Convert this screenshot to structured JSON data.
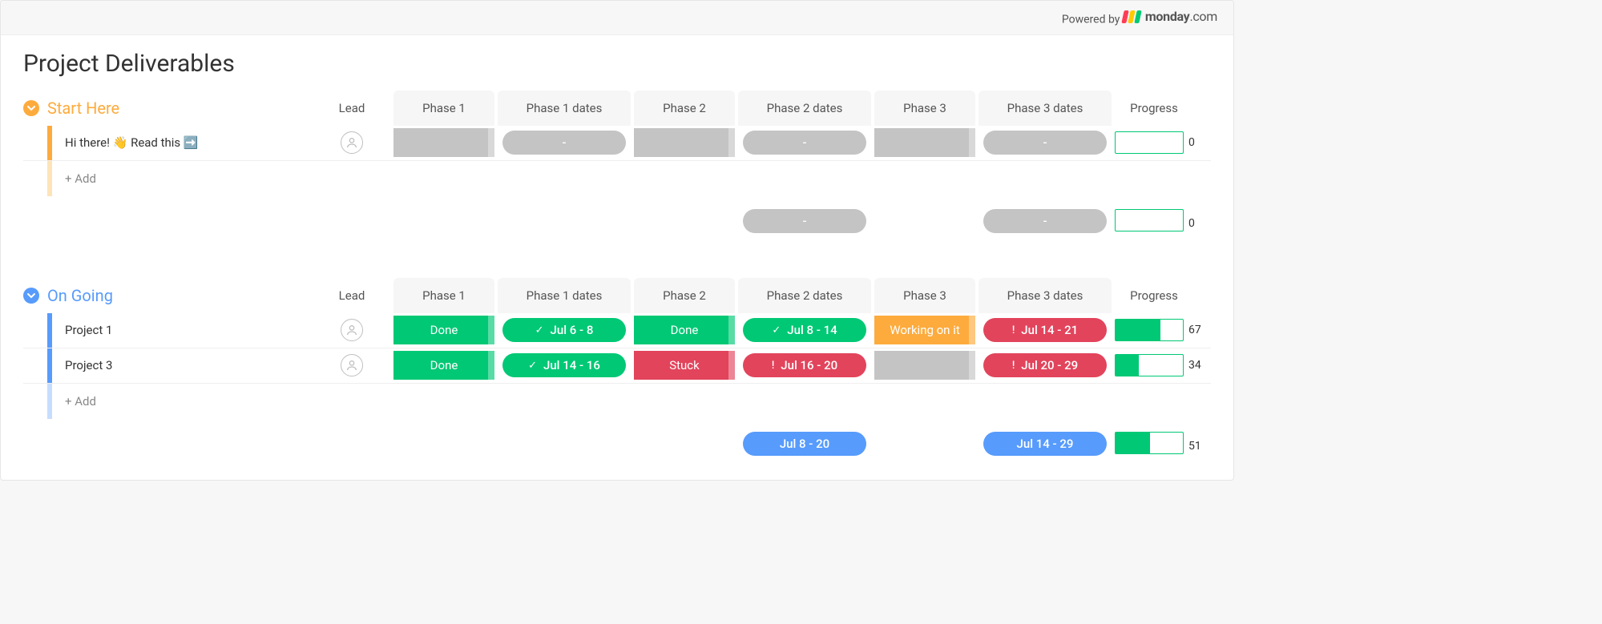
{
  "topbar": {
    "powered_by": "Powered by",
    "brand": "monday",
    "brand_suffix": ".com"
  },
  "board": {
    "title": "Project Deliverables"
  },
  "columns": {
    "lead": "Lead",
    "phase1": "Phase 1",
    "phase1_dates": "Phase 1 dates",
    "phase2": "Phase 2",
    "phase2_dates": "Phase 2 dates",
    "phase3": "Phase 3",
    "phase3_dates": "Phase 3 dates",
    "progress": "Progress"
  },
  "groups": {
    "start_here": {
      "title": "Start Here",
      "color": "yellow",
      "rows": [
        {
          "name": "Hi there! 👋 Read this ➡️",
          "lead": "unassigned",
          "phase1": {
            "label": "",
            "style": "grey"
          },
          "phase1_dates": {
            "text": "-",
            "style": "grey"
          },
          "phase2": {
            "label": "",
            "style": "grey"
          },
          "phase2_dates": {
            "text": "-",
            "style": "grey"
          },
          "phase3": {
            "label": "",
            "style": "grey"
          },
          "phase3_dates": {
            "text": "-",
            "style": "grey"
          },
          "progress": {
            "pct": 0,
            "label": "0"
          }
        }
      ],
      "add_label": "+ Add",
      "summary": {
        "phase2_dates": {
          "text": "-",
          "style": "grey"
        },
        "phase3_dates": {
          "text": "-",
          "style": "grey"
        },
        "progress": {
          "pct": 0,
          "label": "0"
        }
      }
    },
    "on_going": {
      "title": "On Going",
      "color": "blue",
      "rows": [
        {
          "name": "Project 1",
          "lead": "unassigned",
          "phase1": {
            "label": "Done",
            "style": "green"
          },
          "phase1_dates": {
            "text": "Jul 6 - 8",
            "style": "green",
            "icon": "check"
          },
          "phase2": {
            "label": "Done",
            "style": "green"
          },
          "phase2_dates": {
            "text": "Jul 8 - 14",
            "style": "green",
            "icon": "check"
          },
          "phase3": {
            "label": "Working on it",
            "style": "orange"
          },
          "phase3_dates": {
            "text": "Jul 14 - 21",
            "style": "red",
            "icon": "alert"
          },
          "progress": {
            "pct": 67,
            "label": "67"
          }
        },
        {
          "name": "Project 3",
          "lead": "unassigned",
          "phase1": {
            "label": "Done",
            "style": "green"
          },
          "phase1_dates": {
            "text": "Jul 14 - 16",
            "style": "green",
            "icon": "check"
          },
          "phase2": {
            "label": "Stuck",
            "style": "red"
          },
          "phase2_dates": {
            "text": "Jul 16 - 20",
            "style": "red",
            "icon": "alert"
          },
          "phase3": {
            "label": "",
            "style": "grey"
          },
          "phase3_dates": {
            "text": "Jul 20 - 29",
            "style": "red",
            "icon": "alert"
          },
          "progress": {
            "pct": 34,
            "label": "34"
          }
        }
      ],
      "add_label": "+ Add",
      "summary": {
        "phase2_dates": {
          "text": "Jul 8 - 20",
          "style": "blue"
        },
        "phase3_dates": {
          "text": "Jul 14 - 29",
          "style": "blue"
        },
        "progress": {
          "pct": 51,
          "label": "51"
        }
      }
    }
  }
}
